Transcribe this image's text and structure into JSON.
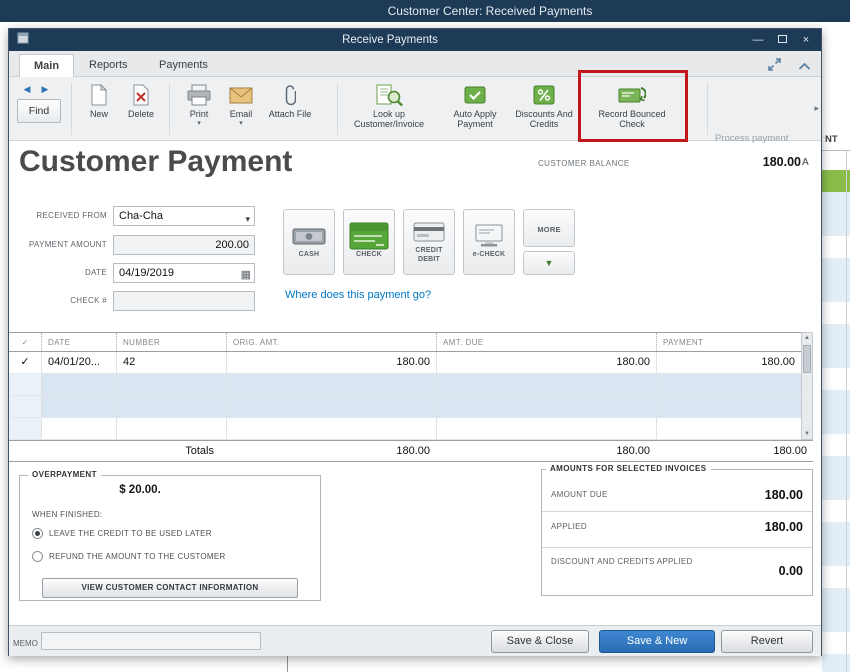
{
  "background": {
    "titlebar": "Customer Center: Received Payments",
    "partial_column_header": "NT"
  },
  "icons": {
    "back_arrow": "◀",
    "forward_arrow": "▶",
    "dropdown_arrow": "▾",
    "checkmark": "✓",
    "calendar": "▦",
    "scroll_up": "▲",
    "scroll_down": "▼",
    "minimize": "—",
    "close": "×",
    "overflow_right": "▸",
    "more_down_arrow": "▼"
  },
  "window": {
    "title": "Receive Payments",
    "tabs": [
      {
        "label": "Main",
        "active": true
      },
      {
        "label": "Reports",
        "active": false
      },
      {
        "label": "Payments",
        "active": false
      }
    ],
    "toolbar": {
      "find": "Find",
      "new": "New",
      "delete": "Delete",
      "print": "Print",
      "email": "Email",
      "attach_file": "Attach File",
      "look_up": "Look up Customer/Invoice",
      "auto_apply": "Auto Apply Payment",
      "discounts": "Discounts And Credits",
      "record_bounced_check": "Record Bounced Check",
      "process_payment": "Process payment",
      "overflow_partial": "A"
    }
  },
  "form": {
    "heading": "Customer Payment",
    "customer_balance_label": "CUSTOMER BALANCE",
    "customer_balance_value": "180.00",
    "received_from_label": "RECEIVED FROM",
    "received_from_value": "Cha-Cha",
    "payment_amount_label": "PAYMENT AMOUNT",
    "payment_amount_value": "200.00",
    "date_label": "DATE",
    "date_value": "04/19/2019",
    "check_number_label": "CHECK #",
    "check_number_value": "",
    "payment_methods": {
      "cash": "CASH",
      "check": "CHECK",
      "credit_debit": "CREDIT DEBIT",
      "echeck": "e-CHECK",
      "more": "MORE"
    },
    "where_link": "Where does this payment go?"
  },
  "table": {
    "headers": {
      "date": "DATE",
      "number": "NUMBER",
      "orig_amt": "ORIG. AMT.",
      "amt_due": "AMT. DUE",
      "payment": "PAYMENT"
    },
    "rows": [
      {
        "checked": true,
        "date": "04/01/20...",
        "number": "42",
        "orig_amt": "180.00",
        "amt_due": "180.00",
        "payment": "180.00"
      }
    ],
    "totals_label": "Totals",
    "totals_orig_amt": "180.00",
    "totals_amt_due": "180.00",
    "totals_payment": "180.00"
  },
  "overpayment": {
    "title": "OVERPAYMENT",
    "amount": "$ 20.00.",
    "when_finished": "WHEN FINISHED:",
    "option_credit": "LEAVE THE CREDIT TO BE USED LATER",
    "option_refund": "REFUND THE AMOUNT TO THE CUSTOMER",
    "view_contact_button": "VIEW CUSTOMER CONTACT INFORMATION"
  },
  "amounts_for_selected": {
    "title": "AMOUNTS FOR SELECTED INVOICES",
    "amount_due_label": "AMOUNT DUE",
    "amount_due_value": "180.00",
    "applied_label": "APPLIED",
    "applied_value": "180.00",
    "discount_label": "DISCOUNT AND CREDITS APPLIED",
    "discount_value": "0.00"
  },
  "footer": {
    "memo_label": "MEMO",
    "memo_value": "",
    "save_close": "Save & Close",
    "save_new": "Save & New",
    "revert": "Revert"
  },
  "colors": {
    "titlebar": "#1d3a56",
    "highlight_red": "#c2161f",
    "primary_button": "#2a6cb4",
    "link": "#0077c5",
    "qb_green": "#57a63a"
  }
}
